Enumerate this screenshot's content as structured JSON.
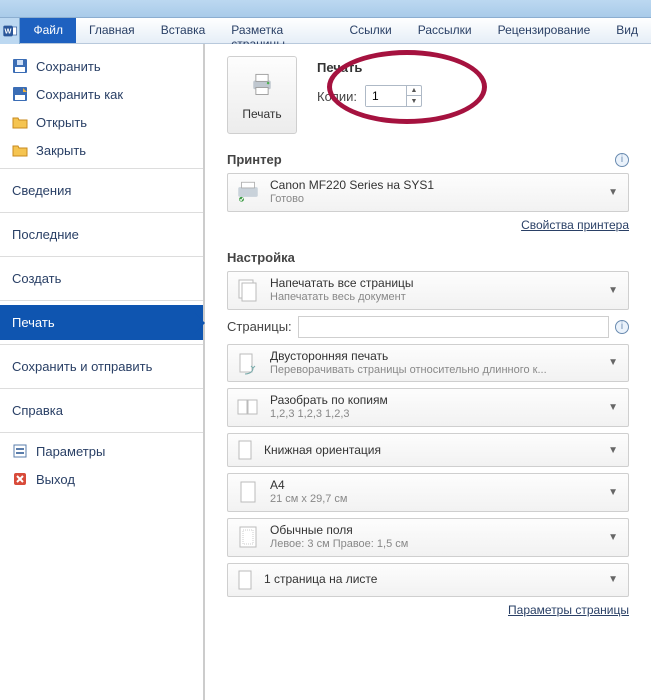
{
  "ribbon": {
    "tabs": [
      "Файл",
      "Главная",
      "Вставка",
      "Разметка страницы",
      "Ссылки",
      "Рассылки",
      "Рецензирование",
      "Вид"
    ]
  },
  "sidebar": {
    "save": "Сохранить",
    "saveAs": "Сохранить как",
    "open": "Открыть",
    "close": "Закрыть",
    "info": "Сведения",
    "recent": "Последние",
    "new": "Создать",
    "print": "Печать",
    "share": "Сохранить и отправить",
    "help": "Справка",
    "options": "Параметры",
    "exit": "Выход"
  },
  "print": {
    "title": "Печать",
    "buttonLabel": "Печать",
    "copiesLabel": "Копии:",
    "copiesValue": "1"
  },
  "printerSection": {
    "header": "Принтер",
    "name": "Canon MF220 Series на SYS1",
    "status": "Готово",
    "propsLink": "Свойства принтера"
  },
  "settings": {
    "header": "Настройка",
    "allPages": {
      "t1": "Напечатать все страницы",
      "t2": "Напечатать весь документ"
    },
    "pagesLabel": "Страницы:",
    "duplex": {
      "t1": "Двусторонняя печать",
      "t2": "Переворачивать страницы относительно длинного к..."
    },
    "collate": {
      "t1": "Разобрать по копиям",
      "t2": "1,2,3   1,2,3   1,2,3"
    },
    "orientation": {
      "t1": "Книжная ориентация"
    },
    "paper": {
      "t1": "A4",
      "t2": "21 см x 29,7 см"
    },
    "margins": {
      "t1": "Обычные поля",
      "t2": "Левое: 3 см   Правое: 1,5 см"
    },
    "perSheet": {
      "t1": "1 страница на листе"
    },
    "pageSetupLink": "Параметры страницы"
  }
}
